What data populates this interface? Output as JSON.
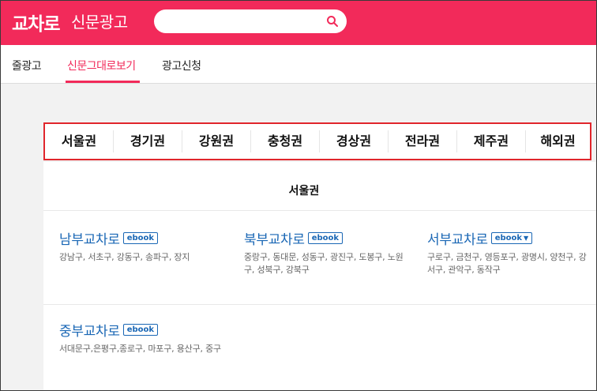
{
  "header": {
    "logo": "교차로",
    "subtitle": "신문광고",
    "search": {
      "placeholder": "",
      "value": ""
    }
  },
  "nav": {
    "items": [
      "줄광고",
      "신문그대로보기",
      "광고신청"
    ],
    "active_index": 1
  },
  "regions": {
    "tabs": [
      "서울권",
      "경기권",
      "강원권",
      "충청권",
      "경상권",
      "전라권",
      "제주권",
      "해외권"
    ],
    "selected": "서울권"
  },
  "section": {
    "title": "서울권",
    "papers": [
      {
        "name": "남부교차로",
        "badge": "ebook",
        "has_dropdown": false,
        "areas": "강남구, 서초구, 강동구, 송파구, 장지"
      },
      {
        "name": "북부교차로",
        "badge": "ebook",
        "has_dropdown": false,
        "areas": "중랑구, 동대문, 성동구, 광진구, 도봉구, 노원구, 성북구, 강북구"
      },
      {
        "name": "서부교차로",
        "badge": "ebook",
        "has_dropdown": true,
        "areas": "구로구, 금천구, 영등포구, 광명시, 양천구, 강서구, 관악구, 동작구"
      },
      {
        "name": "중부교차로",
        "badge": "ebook",
        "has_dropdown": false,
        "areas": "서대문구,은평구,종로구, 마포구, 용산구, 중구"
      }
    ]
  },
  "colors": {
    "brand": "#f22a5a",
    "highlight_border": "#e0262c",
    "link": "#1a67b5"
  }
}
